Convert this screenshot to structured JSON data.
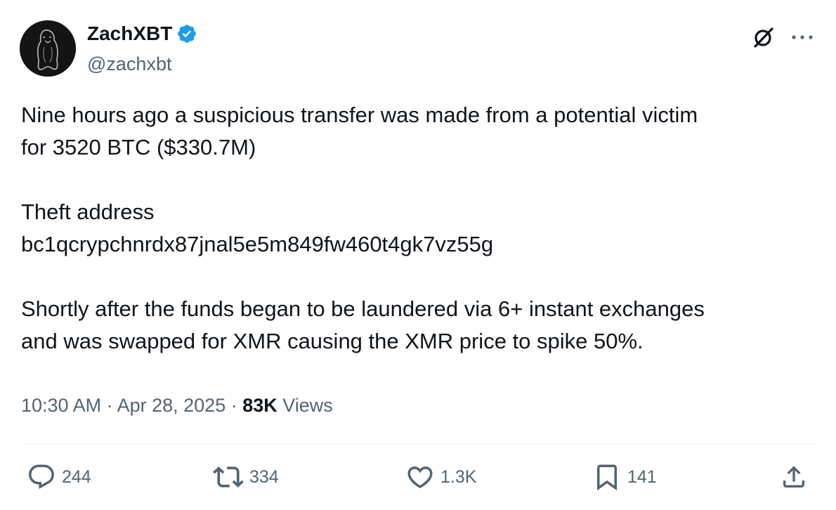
{
  "author": {
    "display_name": "ZachXBT",
    "handle": "@zachxbt",
    "verified": true,
    "verified_color": "#1d9bf0"
  },
  "tweet": {
    "line1": "Nine hours ago a suspicious transfer was made from a potential victim",
    "line2": "for 3520 BTC ($330.7M)",
    "line3": "Theft address",
    "line4": "bc1qcrypchnrdx87jnal5e5m849fw460t4gk7vz55g",
    "line5": "Shortly after the funds began to be laundered via 6+ instant exchanges",
    "line6": "and was swapped for XMR causing the XMR price to spike 50%."
  },
  "meta": {
    "time": "10:30 AM",
    "separator": " · ",
    "date": "Apr 28, 2025",
    "views_count": "83K",
    "views_label": " Views"
  },
  "actions": {
    "replies": "244",
    "reposts": "334",
    "likes": "1.3K",
    "bookmarks": "141"
  },
  "icons": {
    "avatar": "penguin-avatar-icon",
    "verified": "verified-badge-icon",
    "grok": "grok-icon",
    "more": "more-dots-icon",
    "reply": "reply-bubble-icon",
    "repost": "repost-arrows-icon",
    "like": "heart-icon",
    "bookmark": "bookmark-icon",
    "share": "share-upload-icon"
  },
  "colors": {
    "text_primary": "#0f1419",
    "text_secondary": "#536471",
    "divider": "#eff3f4"
  }
}
